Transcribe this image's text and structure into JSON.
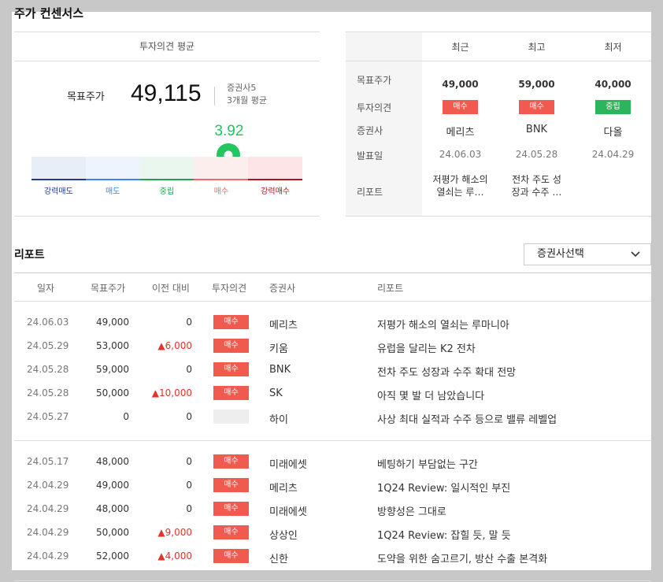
{
  "title": "주가 컨센서스",
  "average": {
    "header": "투자의견 평균",
    "target_label": "목표주가",
    "target_value": "49,115",
    "brokers": "증권사5",
    "period": "3개월 평균",
    "score": "3.92",
    "score_fraction": 0.728,
    "scale": [
      {
        "label": "강력매도",
        "bg": "#e8eef8",
        "line": "#1f3c88",
        "color": "#1f3c88"
      },
      {
        "label": "매도",
        "bg": "#eef4fd",
        "line": "#3b82f6",
        "color": "#3b82f6"
      },
      {
        "label": "중립",
        "bg": "#eaf7ee",
        "line": "#22a34a",
        "color": "#22a34a"
      },
      {
        "label": "매수",
        "bg": "#fdeeee",
        "line": "#ef6b66",
        "color": "#ef6b66"
      },
      {
        "label": "강력매수",
        "bg": "#fde4e6",
        "line": "#b4121b",
        "color": "#b4121b"
      }
    ]
  },
  "recent": {
    "columns": [
      "최근",
      "최고",
      "최저"
    ],
    "row_labels": [
      "목표주가",
      "투자의견",
      "증권사",
      "발표일",
      "리포트"
    ],
    "items": [
      {
        "target": "49,000",
        "opinion": "매수",
        "opinion_type": "buy",
        "broker": "메리츠",
        "date": "24.06.03",
        "report_l1": "저평가 해소의",
        "report_l2": "열쇠는 루…"
      },
      {
        "target": "59,000",
        "opinion": "매수",
        "opinion_type": "buy",
        "broker": "BNK",
        "date": "24.05.28",
        "report_l1": "전차 주도 성",
        "report_l2": "장과 수주 …"
      },
      {
        "target": "40,000",
        "opinion": "중립",
        "opinion_type": "neutral",
        "broker": "다올",
        "date": "24.04.29",
        "report_l1": "",
        "report_l2": ""
      }
    ]
  },
  "reports": {
    "title": "리포트",
    "select_label": "증권사선택",
    "headers": [
      "일자",
      "목표주가",
      "이전 대비",
      "투자의견",
      "증권사",
      "리포트"
    ],
    "rows": [
      {
        "date": "24.06.03",
        "target": "49,000",
        "diff": "0",
        "up": false,
        "opinion": "매수",
        "broker": "메리츠",
        "report": "저평가 해소의 열쇠는 루마니아"
      },
      {
        "date": "24.05.29",
        "target": "53,000",
        "diff": "▲6,000",
        "up": true,
        "opinion": "매수",
        "broker": "키움",
        "report": "유럽을 달리는 K2 전차"
      },
      {
        "date": "24.05.28",
        "target": "59,000",
        "diff": "0",
        "up": false,
        "opinion": "매수",
        "broker": "BNK",
        "report": "전차 주도 성장과 수주 확대 전망"
      },
      {
        "date": "24.05.28",
        "target": "50,000",
        "diff": "▲10,000",
        "up": true,
        "opinion": "매수",
        "broker": "SK",
        "report": "아직 몇 발 더 남았습니다"
      },
      {
        "date": "24.05.27",
        "target": "0",
        "diff": "0",
        "up": false,
        "opinion": "",
        "broker": "하이",
        "report": "사상 최대 실적과 수주 등으로 밸류 레벨업"
      },
      {
        "date": "24.05.17",
        "target": "48,000",
        "diff": "0",
        "up": false,
        "opinion": "매수",
        "broker": "미래에셋",
        "report": "베팅하기 부담없는 구간"
      },
      {
        "date": "24.04.29",
        "target": "49,000",
        "diff": "0",
        "up": false,
        "opinion": "매수",
        "broker": "메리츠",
        "report": "1Q24 Review: 일시적인 부진"
      },
      {
        "date": "24.04.29",
        "target": "48,000",
        "diff": "0",
        "up": false,
        "opinion": "매수",
        "broker": "미래에셋",
        "report": "방향성은 그대로"
      },
      {
        "date": "24.04.29",
        "target": "50,000",
        "diff": "▲9,000",
        "up": true,
        "opinion": "매수",
        "broker": "상상인",
        "report": "1Q24 Review: 잡힐 듯, 말 듯"
      },
      {
        "date": "24.04.29",
        "target": "52,000",
        "diff": "▲4,000",
        "up": true,
        "opinion": "매수",
        "broker": "신한",
        "report": "도약을 위한 숨고르기, 방산 수출 본격화"
      }
    ]
  }
}
